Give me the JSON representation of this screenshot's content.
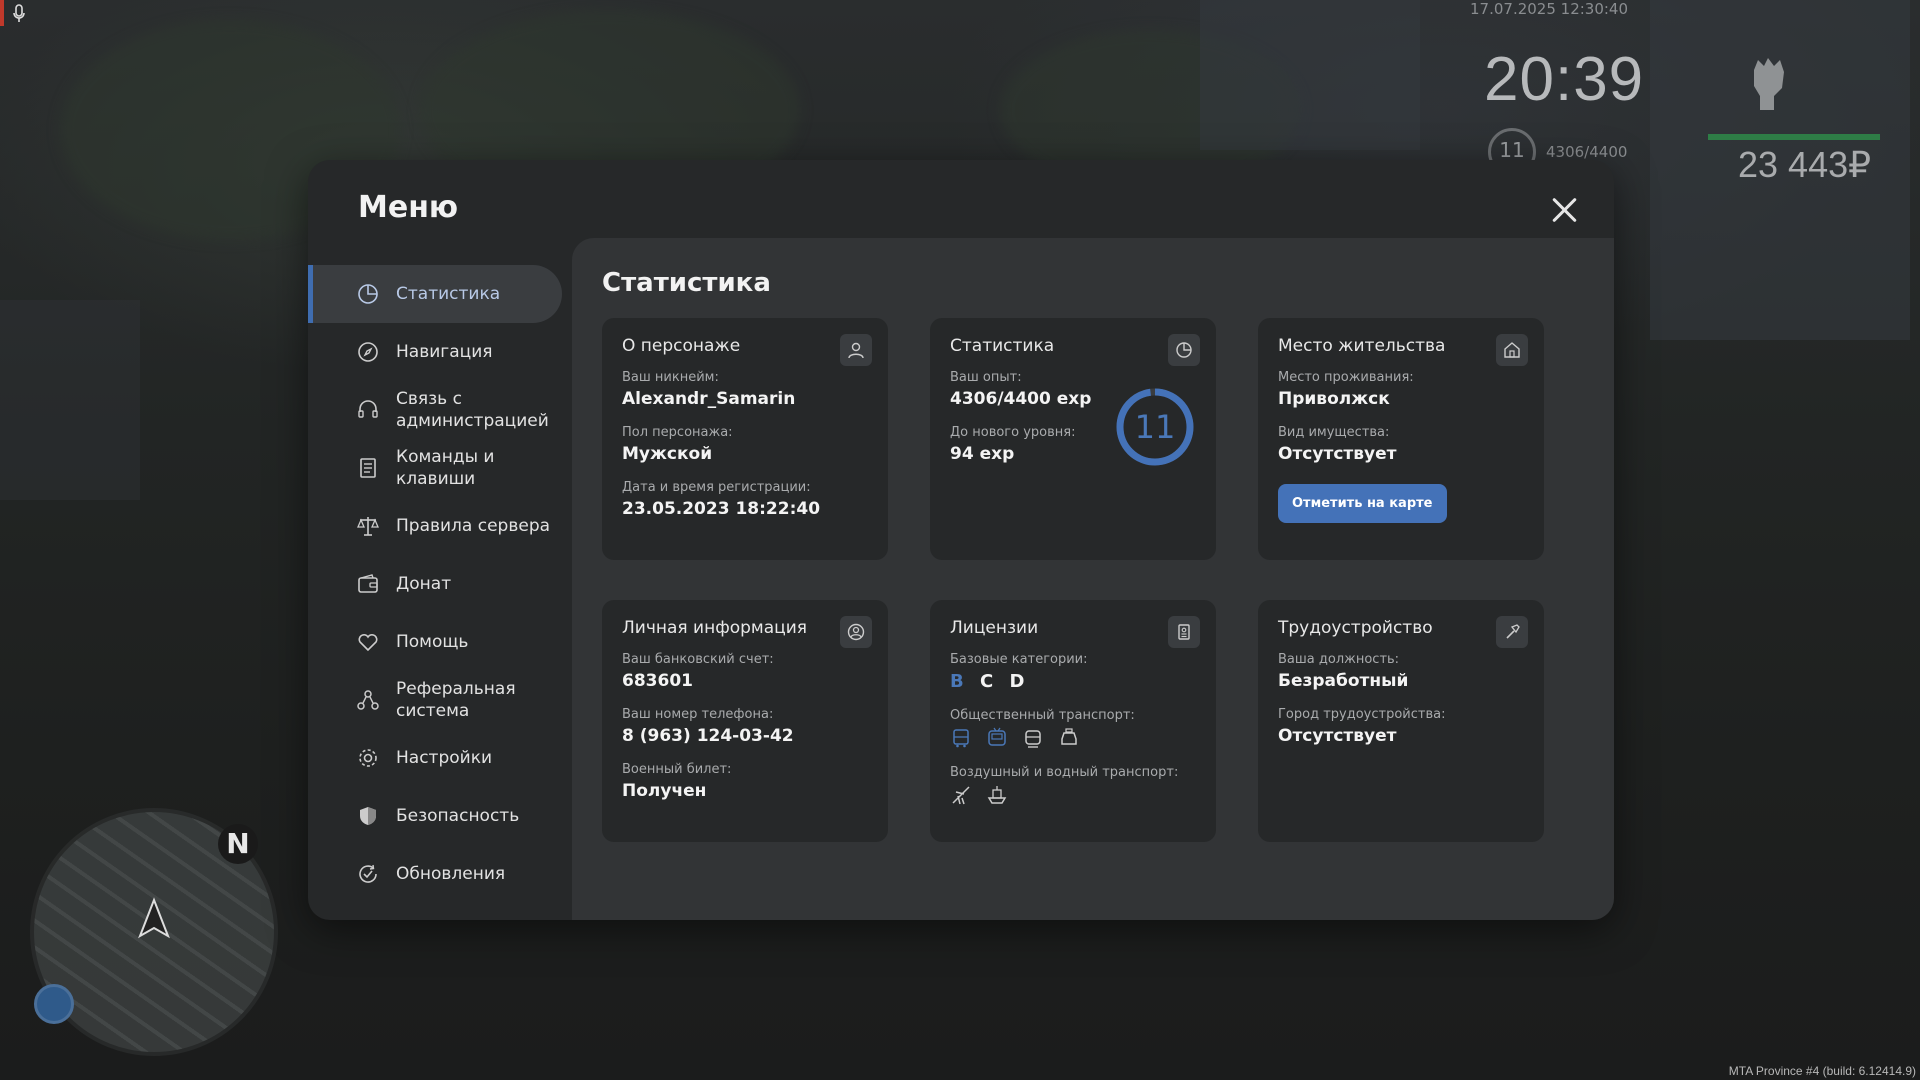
{
  "hud": {
    "datetime": "17.07.2025 12:30:40",
    "time": "20:39",
    "level": "11",
    "exp": "4306/4400",
    "money": "23 443₽",
    "build": "MTA Province #4 (build: 6.12414.9)",
    "compass_n": "N"
  },
  "modal": {
    "title": "Меню",
    "content_title": "Статистика"
  },
  "sidebar": {
    "items": [
      {
        "label": "Статистика",
        "icon": "pie-chart-icon",
        "active": true
      },
      {
        "label": "Навигация",
        "icon": "compass-icon"
      },
      {
        "label": "Связь с администрацией",
        "icon": "headset-icon"
      },
      {
        "label": "Команды и клавиши",
        "icon": "document-list-icon"
      },
      {
        "label": "Правила сервера",
        "icon": "scales-icon"
      },
      {
        "label": "Донат",
        "icon": "wallet-icon"
      },
      {
        "label": "Помощь",
        "icon": "heart-hands-icon"
      },
      {
        "label": "Реферальная система",
        "icon": "referral-network-icon"
      },
      {
        "label": "Настройки",
        "icon": "gear-icon"
      },
      {
        "label": "Безопасность",
        "icon": "shield-icon"
      },
      {
        "label": "Обновления",
        "icon": "refresh-check-icon"
      }
    ]
  },
  "cards": {
    "character": {
      "title": "О персонаже",
      "nickname_label": "Ваш никнейм:",
      "nickname": "Alexandr_Samarin",
      "gender_label": "Пол персонажа:",
      "gender": "Мужской",
      "reg_label": "Дата и время регистрации:",
      "reg": "23.05.2023 18:22:40"
    },
    "stats": {
      "title": "Статистика",
      "exp_label": "Ваш опыт:",
      "exp": "4306/4400 exp",
      "next_label": "До нового уровня:",
      "next": "94 exp",
      "level": "11",
      "progress": 0.978
    },
    "residence": {
      "title": "Место жительства",
      "place_label": "Место проживания:",
      "place": "Приволжск",
      "property_label": "Вид имущества:",
      "property": "Отсутствует",
      "button": "Отметить на карте"
    },
    "personal": {
      "title": "Личная информация",
      "bank_label": "Ваш банковский счет:",
      "bank": "683601",
      "phone_label": "Ваш номер телефона:",
      "phone": "8 (963) 124-03-42",
      "military_label": "Военный билет:",
      "military": "Получен"
    },
    "licenses": {
      "title": "Лицензии",
      "base_label": "Базовые категории:",
      "cat_b": "B",
      "cat_c": "C",
      "cat_d": "D",
      "public_label": "Общественный транспорт:",
      "air_label": "Воздушный и водный транспорт:"
    },
    "employment": {
      "title": "Трудоустройство",
      "position_label": "Ваша должность:",
      "position": "Безработный",
      "city_label": "Город трудоустройства:",
      "city": "Отсутствует"
    }
  },
  "colors": {
    "accent": "#4472b8",
    "active_category": "#4a78b8",
    "hp_bar": "#2e7d46"
  }
}
